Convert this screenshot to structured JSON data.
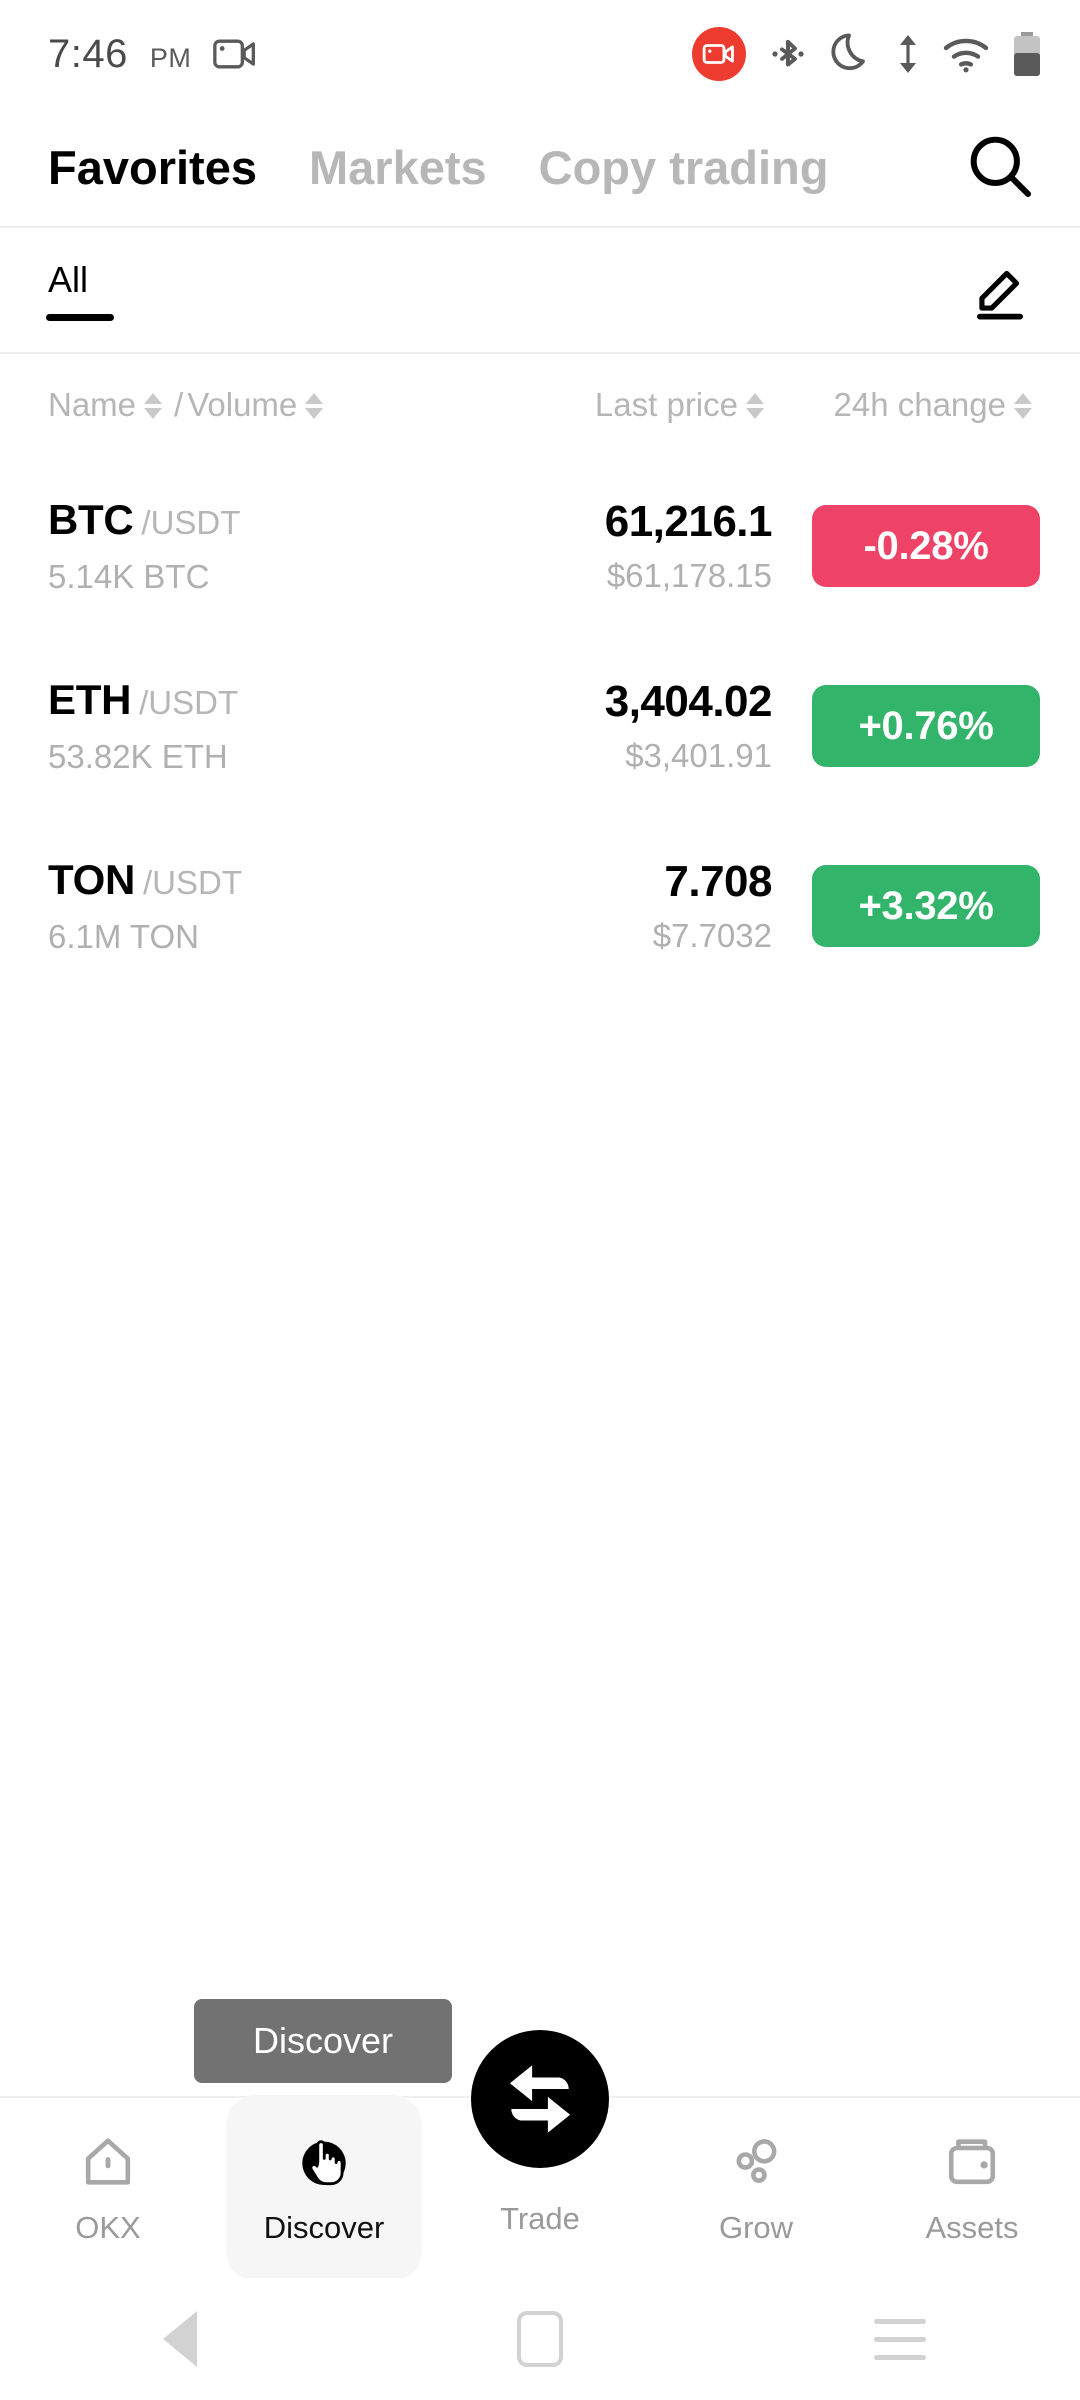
{
  "status_bar": {
    "time": "7:46",
    "ampm": "PM",
    "icons": [
      "screen-record-icon",
      "bluetooth-icon",
      "do-not-disturb-moon-icon",
      "data-transfer-icon",
      "wifi-icon",
      "battery-icon"
    ]
  },
  "header": {
    "tabs": [
      {
        "label": "Favorites",
        "active": true
      },
      {
        "label": "Markets",
        "active": false
      },
      {
        "label": "Copy trading",
        "active": false
      }
    ],
    "search_icon": "search-icon"
  },
  "filter_bar": {
    "chip_label": "All",
    "edit_icon": "edit-pencil-icon"
  },
  "table": {
    "headers": {
      "name": "Name",
      "separator": "/",
      "volume": "Volume",
      "last_price": "Last price",
      "change": "24h change"
    },
    "rows": [
      {
        "base": "BTC",
        "quote": "/USDT",
        "volume": "5.14K BTC",
        "price": "61,216.1",
        "price_usd": "$61,178.15",
        "change": "-0.28%",
        "direction": "down"
      },
      {
        "base": "ETH",
        "quote": "/USDT",
        "volume": "53.82K ETH",
        "price": "3,404.02",
        "price_usd": "$3,401.91",
        "change": "+0.76%",
        "direction": "up"
      },
      {
        "base": "TON",
        "quote": "/USDT",
        "volume": "6.1M TON",
        "price": "7.708",
        "price_usd": "$7.7032",
        "change": "+3.32%",
        "direction": "up"
      }
    ]
  },
  "tooltip": {
    "label": "Discover"
  },
  "bottom_nav": {
    "items": [
      {
        "label": "OKX",
        "icon": "home-icon",
        "active": false
      },
      {
        "label": "Discover",
        "icon": "cursor-hand-icon",
        "active": true
      },
      {
        "label": "Trade",
        "icon": "swap-arrows-icon",
        "active": false
      },
      {
        "label": "Grow",
        "icon": "bubbles-icon",
        "active": false
      },
      {
        "label": "Assets",
        "icon": "wallet-icon",
        "active": false
      }
    ],
    "fab_icon": "swap-arrows-icon"
  },
  "android_nav": {
    "back": "back-triangle-icon",
    "home": "home-square-icon",
    "recents": "recents-menu-icon"
  },
  "colors": {
    "up": "#32B46A",
    "down": "#EE4367",
    "accent": "#000000",
    "record": "#ED3B2F"
  }
}
